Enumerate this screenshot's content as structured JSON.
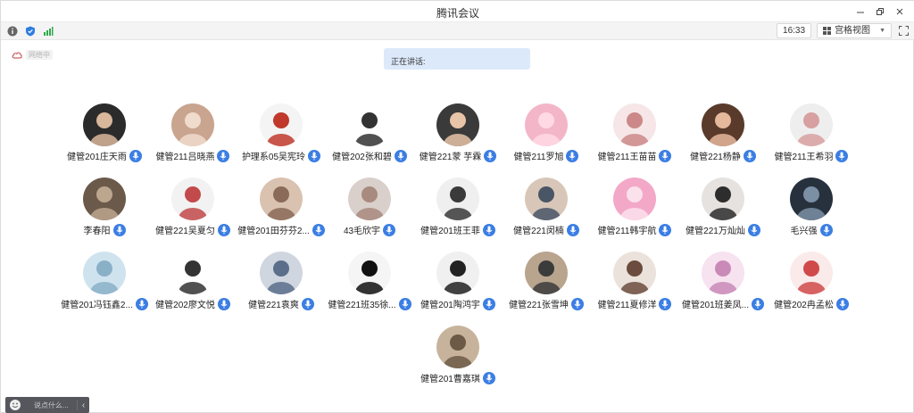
{
  "window": {
    "title": "腾讯会议"
  },
  "toolbar": {
    "time": "16:33",
    "view_label": "宫格视图"
  },
  "network": {
    "label": "网络中"
  },
  "speaking": {
    "label": "正在讲话:"
  },
  "chat": {
    "placeholder": "说点什么..."
  },
  "colors": {
    "accent": "#3b7ee4",
    "banner": "#dce9fa"
  },
  "participants": [
    {
      "name": "健管201庄天雨"
    },
    {
      "name": "健管211吕晓燕"
    },
    {
      "name": "护理系05吴宪玲"
    },
    {
      "name": "健管202张和碧"
    },
    {
      "name": "健管221蒙 芋霖"
    },
    {
      "name": "健管211罗旭"
    },
    {
      "name": "健管211王苗苗"
    },
    {
      "name": "健管221杨静"
    },
    {
      "name": "健管211王希羽"
    },
    {
      "name": "李春阳"
    },
    {
      "name": "健管221吴夏匀"
    },
    {
      "name": "健管201田芬芬2..."
    },
    {
      "name": "43毛欣宇"
    },
    {
      "name": "健管201班王菲"
    },
    {
      "name": "健管221闵楠"
    },
    {
      "name": "健管211韩宇航"
    },
    {
      "name": "健管221万灿灿"
    },
    {
      "name": "毛兴强"
    },
    {
      "name": "健管201冯钰鑫2..."
    },
    {
      "name": "健管202廖文悦"
    },
    {
      "name": "健管221袁爽"
    },
    {
      "name": "健管221班35徐..."
    },
    {
      "name": "健管201陶鸿宇"
    },
    {
      "name": "健管221张雪坤"
    },
    {
      "name": "健管211夏修洋"
    },
    {
      "name": "健管201班姜凤..."
    },
    {
      "name": "健管202冉孟松"
    },
    {
      "name": "健管201曹嘉琪"
    }
  ]
}
